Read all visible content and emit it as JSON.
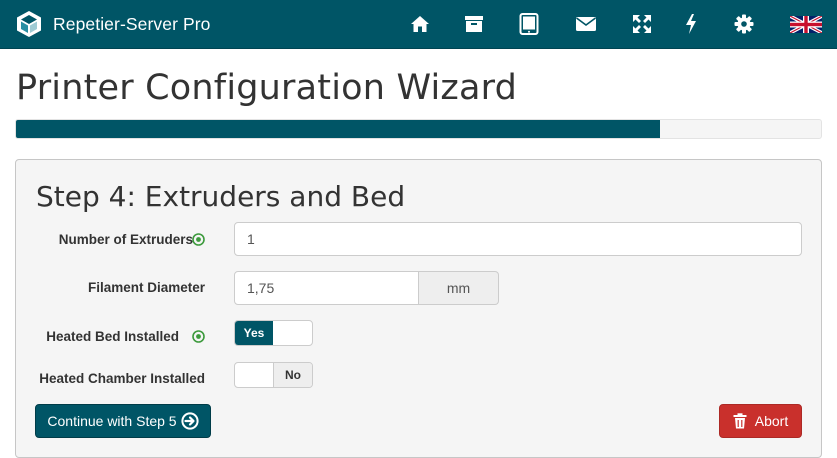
{
  "app": {
    "name": "Repetier-Server Pro"
  },
  "nav": {
    "icons": [
      "home-icon",
      "archive-icon",
      "tablet-icon",
      "envelope-icon",
      "expand-icon",
      "bolt-icon",
      "gear-icon",
      "uk-flag-icon"
    ]
  },
  "wizard": {
    "title": "Printer Configuration Wizard",
    "progress_fraction": 0.8
  },
  "step": {
    "title": "Step 4: Extruders and Bed",
    "fields": {
      "extruders": {
        "label": "Number of Extruders",
        "value": "1"
      },
      "filament": {
        "label": "Filament Diameter",
        "value": "1,75",
        "unit": "mm"
      },
      "heated_bed": {
        "label": "Heated Bed Installed",
        "state_label": "Yes"
      },
      "heated_chamber": {
        "label": "Heated Chamber Installed",
        "state_label": "No"
      }
    },
    "buttons": {
      "continue": "Continue with Step 5",
      "abort": "Abort"
    }
  },
  "colors": {
    "brand": "#005566",
    "danger": "#c9302c",
    "help_green": "#3c9a3c"
  }
}
